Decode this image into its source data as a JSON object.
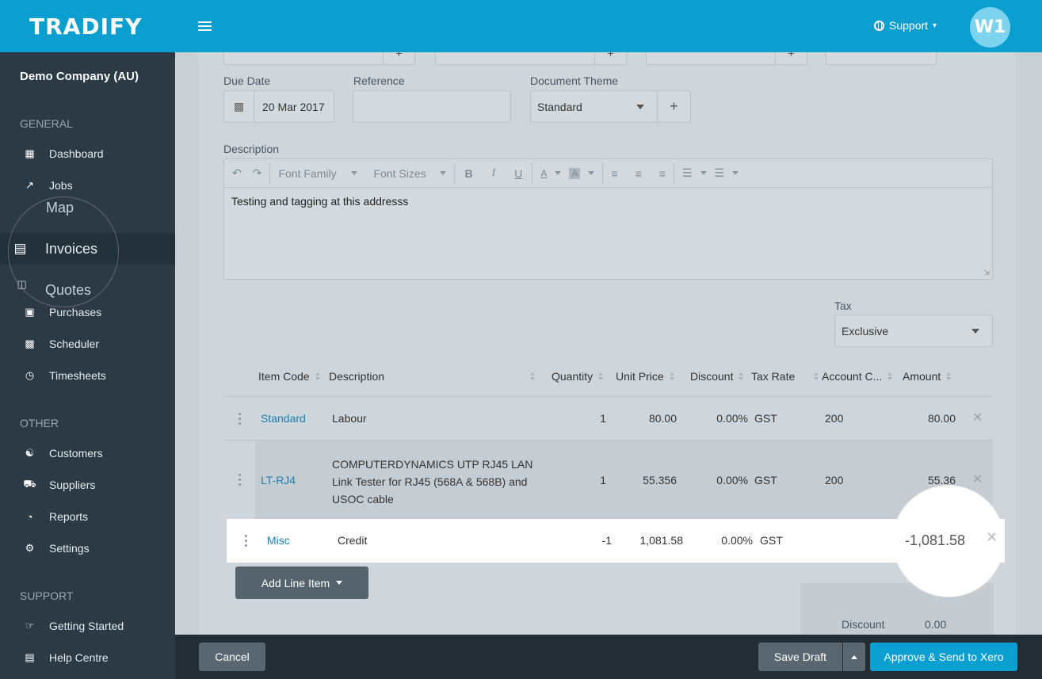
{
  "app": {
    "logo": "TRADIFY"
  },
  "topbar": {
    "support_label": "Support",
    "avatar_initials": "W1"
  },
  "sidebar": {
    "company": "Demo Company (AU)",
    "sections": {
      "general": "GENERAL",
      "other": "OTHER",
      "support": "SUPPORT"
    },
    "items": [
      {
        "label": "Dashboard",
        "icon": "dashboard-icon"
      },
      {
        "label": "Jobs",
        "icon": "hammer-icon"
      },
      {
        "label": "Map",
        "icon": "map-icon"
      },
      {
        "label": "Invoices",
        "icon": "invoice-icon",
        "active": true
      },
      {
        "label": "Quotes",
        "icon": "quote-icon"
      },
      {
        "label": "Purchases",
        "icon": "cart-icon"
      },
      {
        "label": "Scheduler",
        "icon": "calendar-icon"
      },
      {
        "label": "Timesheets",
        "icon": "clock-icon"
      },
      {
        "label": "Customers",
        "icon": "users-icon"
      },
      {
        "label": "Suppliers",
        "icon": "truck-icon"
      },
      {
        "label": "Reports",
        "icon": "pie-chart-icon"
      },
      {
        "label": "Settings",
        "icon": "gear-icon"
      },
      {
        "label": "Getting Started",
        "icon": "thumbs-up-icon"
      },
      {
        "label": "Help Centre",
        "icon": "book-icon"
      }
    ]
  },
  "form": {
    "due_date_label": "Due Date",
    "due_date_value": "20 Mar 2017",
    "reference_label": "Reference",
    "reference_value": "",
    "theme_label": "Document Theme",
    "theme_value": "Standard",
    "description_label": "Description",
    "description_value": "Testing and tagging at this addresss",
    "toolbar": {
      "font_family": "Font Family",
      "font_sizes": "Font Sizes"
    },
    "tax_label": "Tax",
    "tax_value": "Exclusive"
  },
  "table": {
    "headers": [
      "Item Code",
      "Description",
      "Quantity",
      "Unit Price",
      "Discount",
      "Tax Rate",
      "Account C...",
      "Amount"
    ],
    "rows": [
      {
        "code": "Standard",
        "desc": "Labour",
        "qty": "1",
        "unit": "80.00",
        "disc": "0.00%",
        "tax": "GST",
        "acct": "200",
        "amount": "80.00"
      },
      {
        "code": "LT-RJ4",
        "desc1": "COMPUTERDYNAMICS UTP RJ45 LAN",
        "desc2": "Link Tester for RJ45 (568A & 568B) and",
        "desc3": "USOC cable",
        "qty": "1",
        "unit": "55.356",
        "disc": "0.00%",
        "tax": "GST",
        "acct": "200",
        "amount": "55.36"
      },
      {
        "code": "Misc",
        "desc": "Credit",
        "qty": "-1",
        "unit": "1,081.58",
        "disc": "0.00%",
        "tax": "GST",
        "acct": "",
        "amount": "-1,081.58"
      }
    ],
    "add_line_label": "Add Line Item",
    "totals": {
      "discount_label": "Discount",
      "discount_value": "0.00"
    }
  },
  "footer": {
    "cancel": "Cancel",
    "save_draft": "Save Draft",
    "approve": "Approve & Send to Xero"
  },
  "colors": {
    "brand": "#0a9fcf",
    "sidebar": "#2b3a45",
    "link": "#1a7fb0"
  }
}
